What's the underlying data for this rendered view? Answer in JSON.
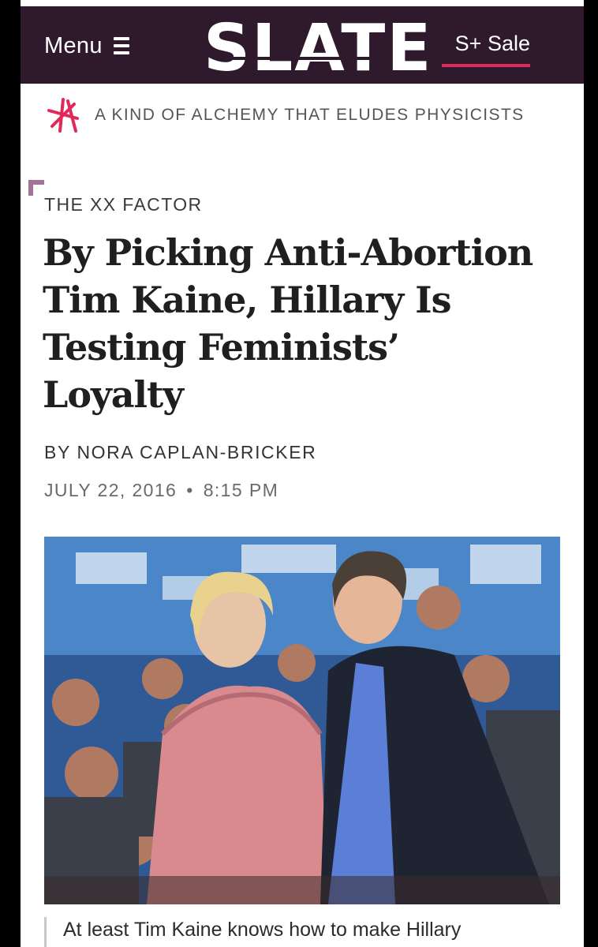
{
  "nav": {
    "menu_label": "Menu",
    "logo_text": "SLATE",
    "sale_label": "S+ Sale"
  },
  "promo": {
    "text": "A KIND OF ALCHEMY THAT ELUDES PHYSICISTS",
    "icon": "slate-plus-star-icon"
  },
  "article": {
    "kicker": "THE XX FACTOR",
    "headline": "By Picking Anti-Abortion Tim Kaine, Hillary Is Testing Feminists’ Loyalty",
    "byline": "BY NORA CAPLAN-BRICKER",
    "date": "JULY 22, 2016",
    "date_separator": "•",
    "time": "8:15 PM",
    "caption": "At least Tim Kaine knows how to make Hillary"
  },
  "colors": {
    "nav_background": "#2e1a2c",
    "accent": "#e1285a",
    "kicker_corner": "#a07497"
  }
}
